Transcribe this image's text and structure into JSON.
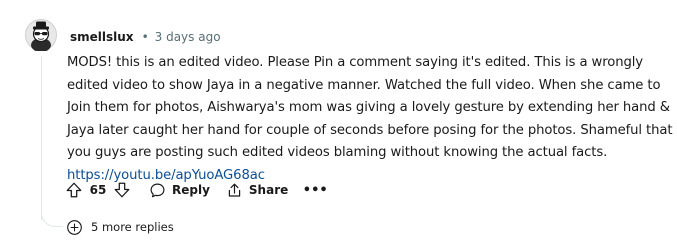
{
  "comment": {
    "username": "smellslux",
    "separator": "•",
    "time_ago": "3 days ago",
    "body_text": "MODS! this is an edited video. Please Pin a comment saying it's edited. This is a wrongly edited video to show Jaya in a negative manner. Watched the full video. When she came to Join them for photos, Aishwarya's mom was giving a lovely gesture by extending her hand & Jaya later caught her hand for couple of seconds before posing for the photos. Shameful that you guys are posting such edited videos blaming without knowing the actual facts.",
    "link_text": "https://youtu.be/apYuoAG68ac",
    "score": "65",
    "reply_label": "Reply",
    "share_label": "Share",
    "more_label": "•••",
    "more_replies_label": "5 more replies"
  },
  "icons": {
    "avatar": "avatar-icon",
    "upvote": "upvote-arrow-icon",
    "downvote": "downvote-arrow-icon",
    "reply": "speech-bubble-icon",
    "share": "share-icon",
    "more": "ellipsis-icon",
    "expand": "plus-circle-icon"
  },
  "colors": {
    "text": "#1a1a1b",
    "meta": "#576f76",
    "link": "#0a4e9b",
    "thread": "#e3e6e8"
  }
}
